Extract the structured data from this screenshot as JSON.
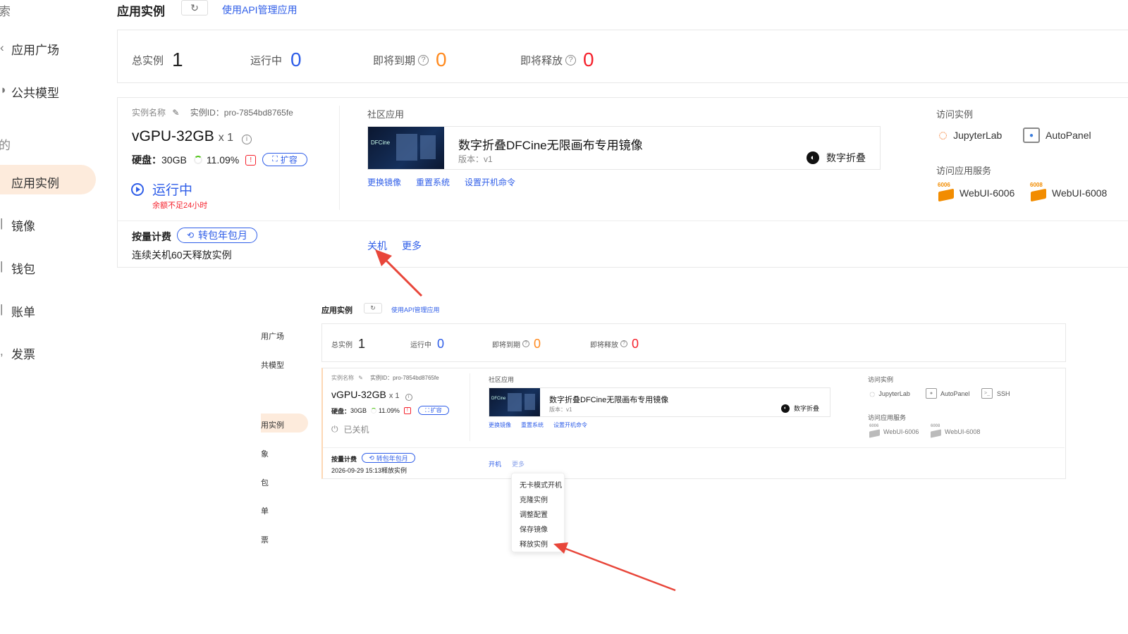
{
  "sidebar": {
    "cut_top": "索",
    "items": [
      {
        "label": "应用广场"
      },
      {
        "label": "公共模型"
      },
      {
        "label": "的"
      },
      {
        "label": "应用实例"
      },
      {
        "label": "镜像"
      },
      {
        "label": "钱包"
      },
      {
        "label": "账单"
      },
      {
        "label": "发票"
      }
    ]
  },
  "header": {
    "title": "应用实例",
    "api_link": "使用API管理应用"
  },
  "stats": {
    "total_label": "总实例",
    "total_value": "1",
    "running_label": "运行中",
    "running_value": "0",
    "expiring_label": "即将到期",
    "expiring_value": "0",
    "releasing_label": "即将释放",
    "releasing_value": "0"
  },
  "instance": {
    "name_label": "实例名称",
    "id_text": "实例ID：pro-7854bd8765fe",
    "gpu": "vGPU-32GB",
    "qty": "x 1",
    "disk_label": "硬盘：",
    "disk_value": "30GB",
    "disk_usage": "11.09%",
    "expand_label": "扩容",
    "status_running": "运行中",
    "status_stopped": "已关机",
    "warning": "余额不足24小时",
    "billing_label": "按量计费",
    "convert_label": "转包年包月",
    "release_note_1": "连续关机60天释放实例",
    "release_note_2": "2026-09-29 15:13释放实例"
  },
  "community_app": {
    "section_label": "社区应用",
    "name": "数字折叠DFCine无限画布专用镜像",
    "version": "版本：v1",
    "publisher": "数字折叠",
    "thumb_text": "DFCine",
    "actions": [
      "更换镜像",
      "重置系统",
      "设置开机命令"
    ]
  },
  "access": {
    "instance_label": "访问实例",
    "jupyter": "JupyterLab",
    "autopanel": "AutoPanel",
    "ssh": "SSH",
    "service_label": "访问应用服务",
    "svc1": "WebUI-6006",
    "svc2": "WebUI-6008",
    "svc_badge1": "6006",
    "svc_badge2": "6008"
  },
  "ops": {
    "shutdown": "关机",
    "start": "开机",
    "more": "更多"
  },
  "more_menu": [
    "无卡模式开机",
    "克隆实例",
    "调整配置",
    "保存镜像",
    "释放实例"
  ],
  "inset_sidebar": [
    "用广场",
    "共模型",
    "用实例",
    "象",
    "包",
    "单",
    "票"
  ],
  "colors": {
    "accent": "#2f5ee8",
    "orange": "#ff8a1f",
    "red": "#f5222d",
    "active_bg": "#fdebdc",
    "arrow": "#e8463a"
  }
}
